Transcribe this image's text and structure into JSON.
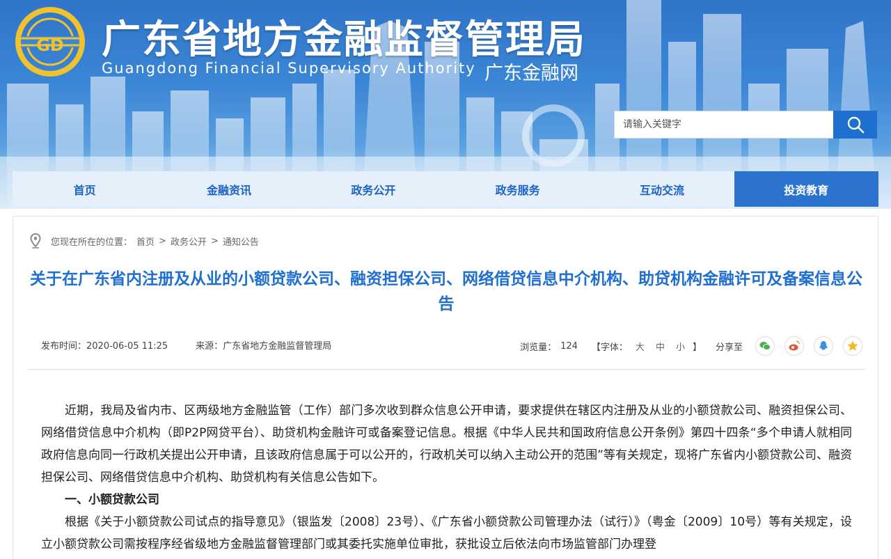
{
  "header": {
    "title_cn": "广东省地方金融监督管理局",
    "title_en": "Guangdong Financial Supervisory Authority",
    "title_net": "广东金融网",
    "logo_text": "GD"
  },
  "search": {
    "placeholder": "请输入关键字"
  },
  "nav": {
    "items": [
      {
        "label": "首页"
      },
      {
        "label": "金融资讯"
      },
      {
        "label": "政务公开"
      },
      {
        "label": "政务服务"
      },
      {
        "label": "互动交流"
      },
      {
        "label": "投资教育"
      }
    ],
    "active_index": 5
  },
  "breadcrumb": {
    "prefix": "您现在所在的位置：",
    "items": [
      "首页",
      "政务公开",
      "通知公告"
    ],
    "separator": ">"
  },
  "article": {
    "title": "关于在广东省内注册及从业的小额贷款公司、融资担保公司、网络借贷信息中介机构、助贷机构金融许可及备案信息公告",
    "publish_label": "发布时间：",
    "publish_time": "2020-06-05 11:25",
    "source_label": "来源：",
    "source": "广东省地方金融监督管理局",
    "views_label": "浏览量：",
    "views": "124",
    "font_label_open": "【字体：",
    "font_large": "大",
    "font_medium": "中",
    "font_small": "小",
    "font_label_close": "】",
    "share_label": "分享至",
    "paragraph1": "近期，我局及省内市、区两级地方金融监管（工作）部门多次收到群众信息公开申请，要求提供在辖区内注册及从业的小额贷款公司、融资担保公司、网络借贷信息中介机构（即P2P网贷平台）、助贷机构金融许可或备案登记信息。根据《中华人民共和国政府信息公开条例》第四十四条“多个申请人就相同政府信息向同一行政机关提出公开申请，且该政府信息属于可以公开的，行政机关可以纳入主动公开的范围”等有关规定，现将广东省内小额贷款公司、融资担保公司、网络借贷信息中介机构、助贷机构有关信息公告如下。",
    "section1_heading": "一、小额贷款公司",
    "paragraph2": "根据《关于小额贷款公司试点的指导意见》（银监发〔2008〕23号）、《广东省小额贷款公司管理办法（试行）》（粤金〔2009〕10号）等有关规定，设立小额贷款公司需按程序经省级地方金融监督管理部门或其委托实施单位审批，获批设立后依法向市场监管部门办理登"
  },
  "colors": {
    "primary": "#1f6fd1",
    "nav_bg": "#e6f0fb",
    "nav_active": "#2c73cf",
    "wechat": "#4caf50",
    "weibo": "#e0533c",
    "qq": "#3a8fe0",
    "qzone": "#f5b820"
  }
}
